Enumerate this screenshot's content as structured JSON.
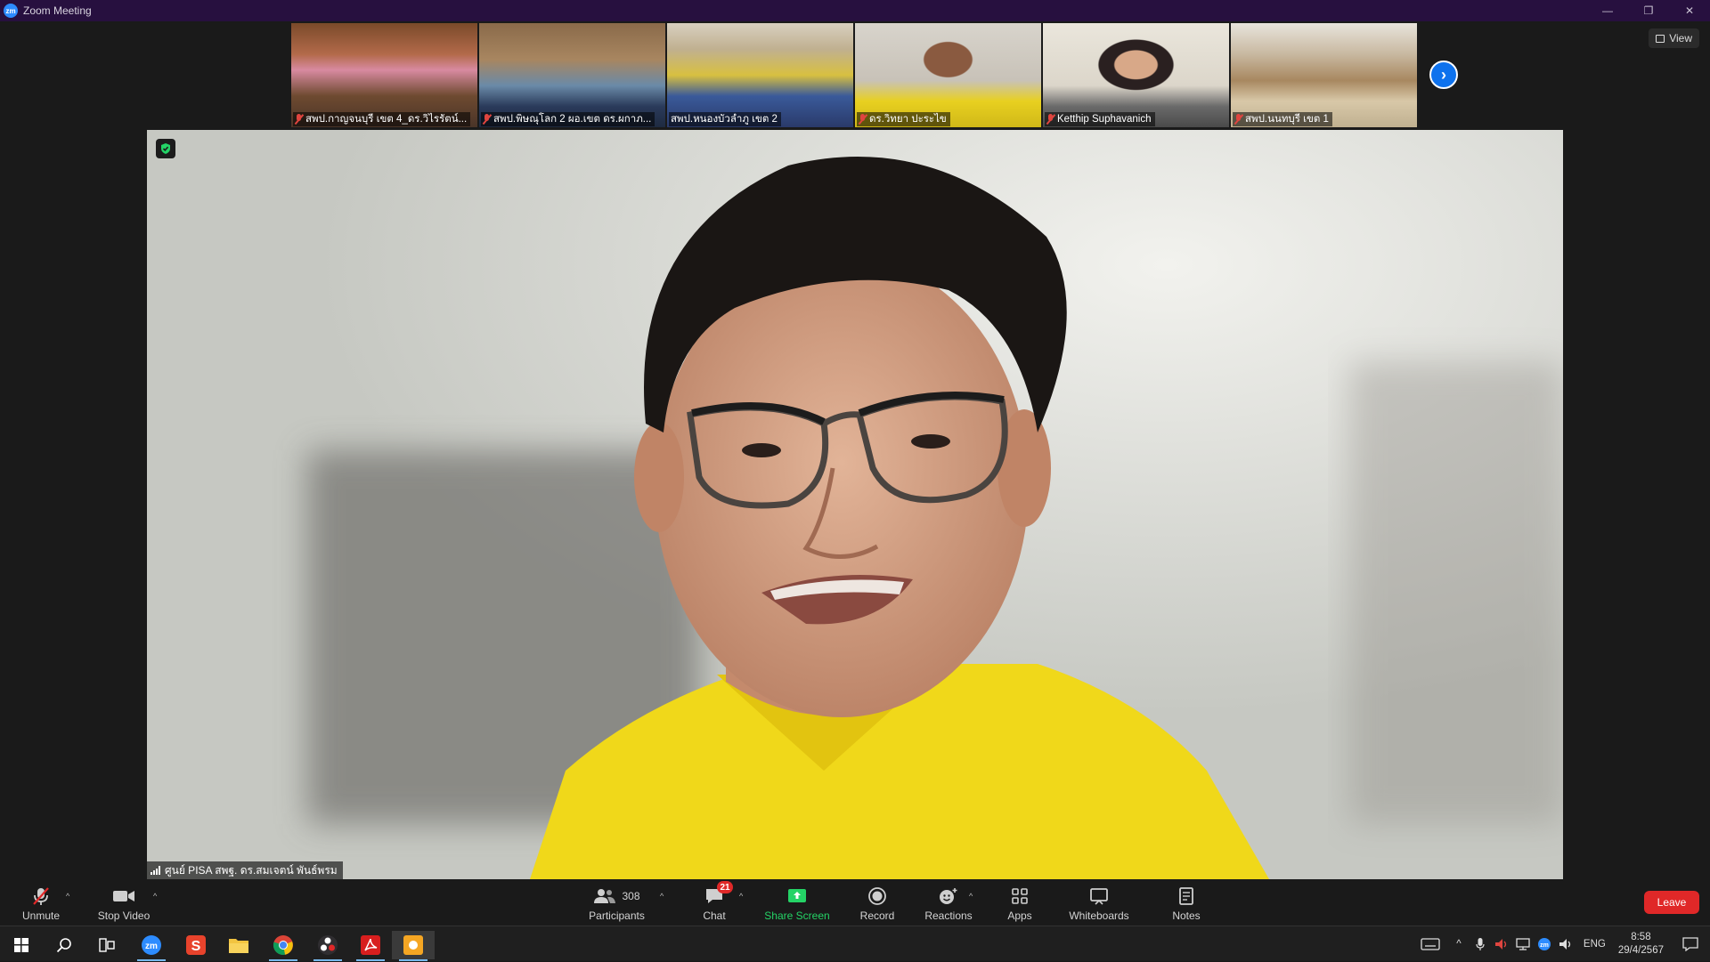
{
  "window": {
    "title": "Zoom Meeting",
    "app_icon": "zm"
  },
  "window_controls": {
    "minimize": "—",
    "restore": "❐",
    "close": "✕"
  },
  "view_button": {
    "label": "View"
  },
  "thumbnails": [
    {
      "name": "สพป.กาญจนบุรี เขต 4_ดร.วิไรรัตน์...",
      "muted": true
    },
    {
      "name": "สพป.พิษณุโลก 2 ผอ.เขต ดร.ผกาภ...",
      "muted": true
    },
    {
      "name": "สพป.หนองบัวลำภู เขต 2",
      "muted": false
    },
    {
      "name": "ดร.วิทยา ปะระไข",
      "muted": true
    },
    {
      "name": "Ketthip Suphavanich",
      "muted": true
    },
    {
      "name": "สพป.นนทบุรี เขต 1",
      "muted": true
    }
  ],
  "main_video": {
    "speaker_name": "ศูนย์ PISA สพฐ. ดร.สมเจตน์ พันธ์พรม"
  },
  "toolbar": {
    "unmute": "Unmute",
    "stop_video": "Stop Video",
    "participants": "Participants",
    "participants_count": "308",
    "chat": "Chat",
    "chat_badge": "21",
    "share_screen": "Share Screen",
    "record": "Record",
    "reactions": "Reactions",
    "apps": "Apps",
    "whiteboards": "Whiteboards",
    "notes": "Notes",
    "leave": "Leave"
  },
  "taskbar": {
    "language": "ENG",
    "time": "8:58",
    "date": "29/4/2567"
  },
  "colors": {
    "title_bar": "#27103f",
    "accent_blue": "#0e72ed",
    "leave_red": "#e02828",
    "share_green": "#24d366"
  }
}
